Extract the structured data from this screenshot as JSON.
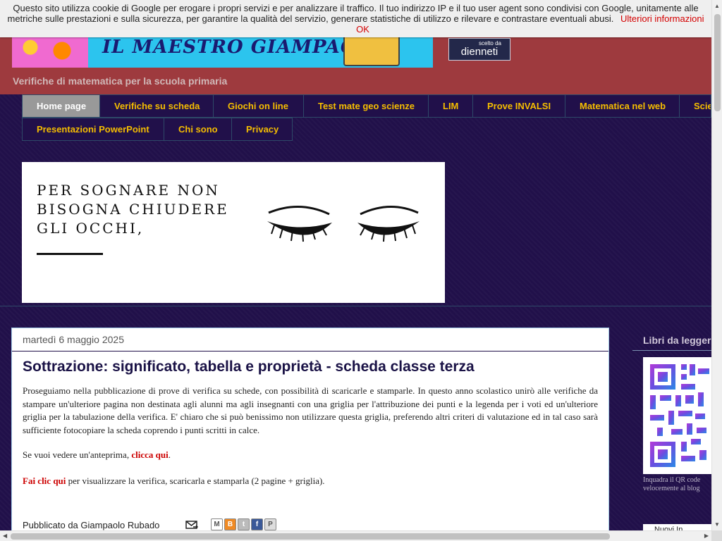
{
  "cookie_bar": {
    "text": "Questo sito utilizza cookie di Google per erogare i propri servizi e per analizzare il traffico. Il tuo indirizzo IP e il tuo user agent sono condivisi con Google, unitamente alle metriche sulle prestazioni e sulla sicurezza, per garantire la qualità del servizio, generare statistiche di utilizzo e rilevare e contrastare eventuali abusi.",
    "more_info_label": "Ulteriori informazioni",
    "ok_label": "OK"
  },
  "header": {
    "banner_title": "IL MAESTRO GIAMPAOLO",
    "badge_line1": "scelto da",
    "badge_line2": "dienneti",
    "tagline": "Verifiche di matematica per la scuola primaria"
  },
  "nav": {
    "items": [
      {
        "label": "Home page",
        "active": true
      },
      {
        "label": "Verifiche su scheda"
      },
      {
        "label": "Giochi on line"
      },
      {
        "label": "Test mate geo scienze"
      },
      {
        "label": "LIM"
      },
      {
        "label": "Prove INVALSI"
      },
      {
        "label": "Matematica nel web"
      },
      {
        "label": "Scienze"
      },
      {
        "label": "Presentazioni PowerPoint"
      },
      {
        "label": "Chi sono"
      },
      {
        "label": "Privacy"
      }
    ]
  },
  "hero": {
    "line1": "PER SOGNARE NON",
    "line2": "BISOGNA CHIUDERE",
    "line3": "GLI OCCHI,"
  },
  "post": {
    "date": "martedì 6 maggio 2025",
    "title": "Sottrazione: significato, tabella e proprietà - scheda classe terza",
    "paragraph1": "Proseguiamo nella pubblicazione di prove di verifica su schede, con possibilità di scaricarle e stamparle. In questo anno scolastico unirò alle verifiche da stampare un'ulteriore pagina non destinata agli alunni ma agli insegnanti con una griglia per l'attribuzione dei punti e la legenda per i voti ed un'ulteriore griglia per la tabulazione della verifica. E' chiaro che si può benissimo non utilizzare questa griglia, preferendo altri criteri di valutazione ed in tal caso sarà sufficiente fotocopiare la scheda coprendo i punti scritti in calce.",
    "preview_prefix": "Se vuoi vedere un'anteprima, ",
    "preview_link": "clicca qui",
    "preview_suffix": ".",
    "download_link": "Fai clic qui",
    "download_suffix": " per visualizzare la verifica, scaricarla e stamparla (2 pagine + griglia).",
    "footer": "Pubblicato da Giampaolo Rubado"
  },
  "sidebar": {
    "title": "Libri da leggere",
    "qr_caption_line1": "Inquadra il QR code",
    "qr_caption_line2": "velocemente al blog",
    "next_box": "Nuovi In..."
  }
}
